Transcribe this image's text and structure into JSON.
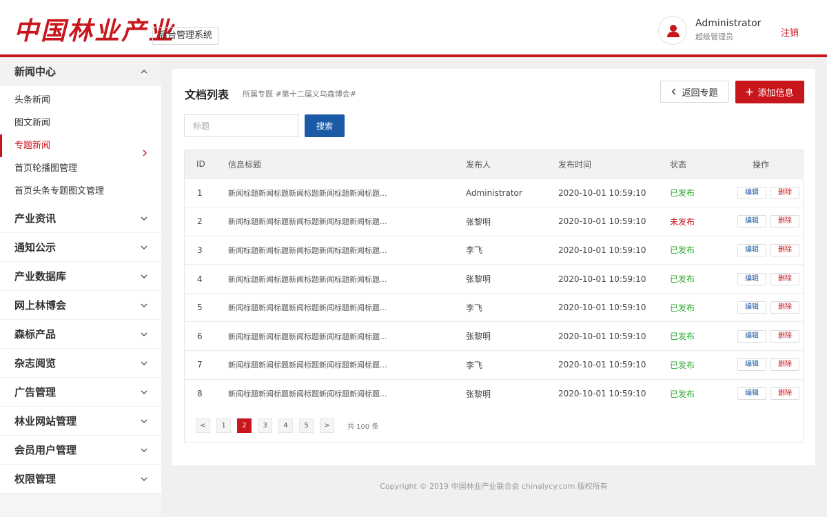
{
  "header": {
    "logo_text": "中国林业产业",
    "system_name": "后台管理系统",
    "user_name": "Administrator",
    "user_role": "超级管理员",
    "logout": "注销"
  },
  "sidebar": {
    "open_group": {
      "label": "新闻中心",
      "items": [
        {
          "label": "头条新闻"
        },
        {
          "label": "图文新闻"
        },
        {
          "label": "专题新闻",
          "active": true
        },
        {
          "label": "首页轮播图管理"
        },
        {
          "label": "首页头条专题图文管理"
        }
      ]
    },
    "groups": [
      {
        "label": "产业资讯"
      },
      {
        "label": "通知公示"
      },
      {
        "label": "产业数据库"
      },
      {
        "label": "网上林博会"
      },
      {
        "label": "森标产品"
      },
      {
        "label": "杂志阅览"
      },
      {
        "label": "广告管理"
      },
      {
        "label": "林业网站管理"
      },
      {
        "label": "会员用户管理"
      },
      {
        "label": "权限管理"
      }
    ]
  },
  "main": {
    "title": "文档列表",
    "subject": "所属专题 #第十二届义乌森博会#",
    "back_button": "返回专题",
    "add_button": "添加信息",
    "search_placeholder": "标题",
    "search_button": "搜索",
    "columns": [
      "ID",
      "信息标题",
      "发布人",
      "发布时间",
      "状态",
      "操作"
    ],
    "rows": [
      {
        "id": "1",
        "title": "新闻标题新闻标题新闻标题新闻标题新闻标题...",
        "author": "Administrator",
        "time": "2020-10-01 10:59:10",
        "status": "已发布",
        "published": true
      },
      {
        "id": "2",
        "title": "新闻标题新闻标题新闻标题新闻标题新闻标题...",
        "author": "张黎明",
        "time": "2020-10-01 10:59:10",
        "status": "未发布",
        "published": false
      },
      {
        "id": "3",
        "title": "新闻标题新闻标题新闻标题新闻标题新闻标题...",
        "author": "李飞",
        "time": "2020-10-01 10:59:10",
        "status": "已发布",
        "published": true
      },
      {
        "id": "4",
        "title": "新闻标题新闻标题新闻标题新闻标题新闻标题...",
        "author": "张黎明",
        "time": "2020-10-01 10:59:10",
        "status": "已发布",
        "published": true
      },
      {
        "id": "5",
        "title": "新闻标题新闻标题新闻标题新闻标题新闻标题...",
        "author": "李飞",
        "time": "2020-10-01 10:59:10",
        "status": "已发布",
        "published": true
      },
      {
        "id": "6",
        "title": "新闻标题新闻标题新闻标题新闻标题新闻标题...",
        "author": "张黎明",
        "time": "2020-10-01 10:59:10",
        "status": "已发布",
        "published": true
      },
      {
        "id": "7",
        "title": "新闻标题新闻标题新闻标题新闻标题新闻标题...",
        "author": "李飞",
        "time": "2020-10-01 10:59:10",
        "status": "已发布",
        "published": true
      },
      {
        "id": "8",
        "title": "新闻标题新闻标题新闻标题新闻标题新闻标题...",
        "author": "张黎明",
        "time": "2020-10-01 10:59:10",
        "status": "已发布",
        "published": true
      }
    ],
    "edit_label": "编辑",
    "delete_label": "删除",
    "pagination": {
      "prev": "<",
      "next": ">",
      "pages": [
        "1",
        "2",
        "3",
        "4",
        "5"
      ],
      "current": "2",
      "total": "共 100 条"
    }
  },
  "footer": {
    "copyright": "Copyright © 2019 中国林业产业联合会 chinalycy.com 版权所有"
  },
  "colors": {
    "brand_red": "#c8161d",
    "primary_blue": "#1b5aa6",
    "published_green": "#2aa52a"
  }
}
